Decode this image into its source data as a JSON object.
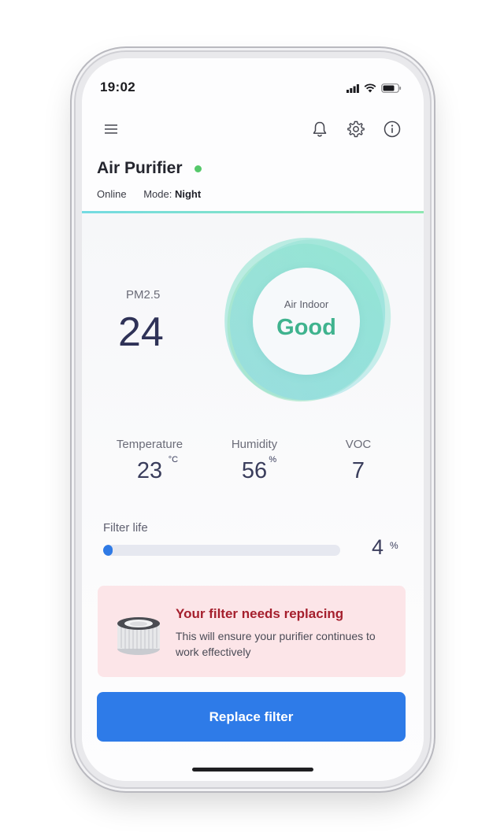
{
  "status_bar": {
    "time": "19:02",
    "signal_icon": "signal-icon",
    "wifi_icon": "wifi-icon",
    "battery_icon": "battery-icon"
  },
  "header": {
    "menu_icon": "menu-icon",
    "bell_icon": "bell-icon",
    "settings_icon": "gear-icon",
    "info_icon": "info-icon"
  },
  "device": {
    "title": "Air Purifier",
    "connection": "Online",
    "mode_label": "Mode:",
    "mode_value": "Night"
  },
  "pm": {
    "label": "PM2.5",
    "value": "24"
  },
  "air_quality": {
    "label": "Air Indoor",
    "value": "Good"
  },
  "metrics": [
    {
      "label": "Temperature",
      "value": "23",
      "unit": "°C"
    },
    {
      "label": "Humidity",
      "value": "56",
      "unit": "%"
    },
    {
      "label": "VOC",
      "value": "7",
      "unit": ""
    }
  ],
  "filter": {
    "label": "Filter life",
    "value": "4",
    "unit": "%",
    "percent": 4
  },
  "alert": {
    "title": "Your filter needs replacing",
    "body": "This will ensure your purifier continues to work effectively"
  },
  "cta": {
    "label": "Replace filter"
  },
  "colors": {
    "accent": "#2e7be8",
    "good": "#3fb38e",
    "alert_bg": "#fce5e8",
    "alert_title": "#a51f2d",
    "online": "#55c86a"
  }
}
